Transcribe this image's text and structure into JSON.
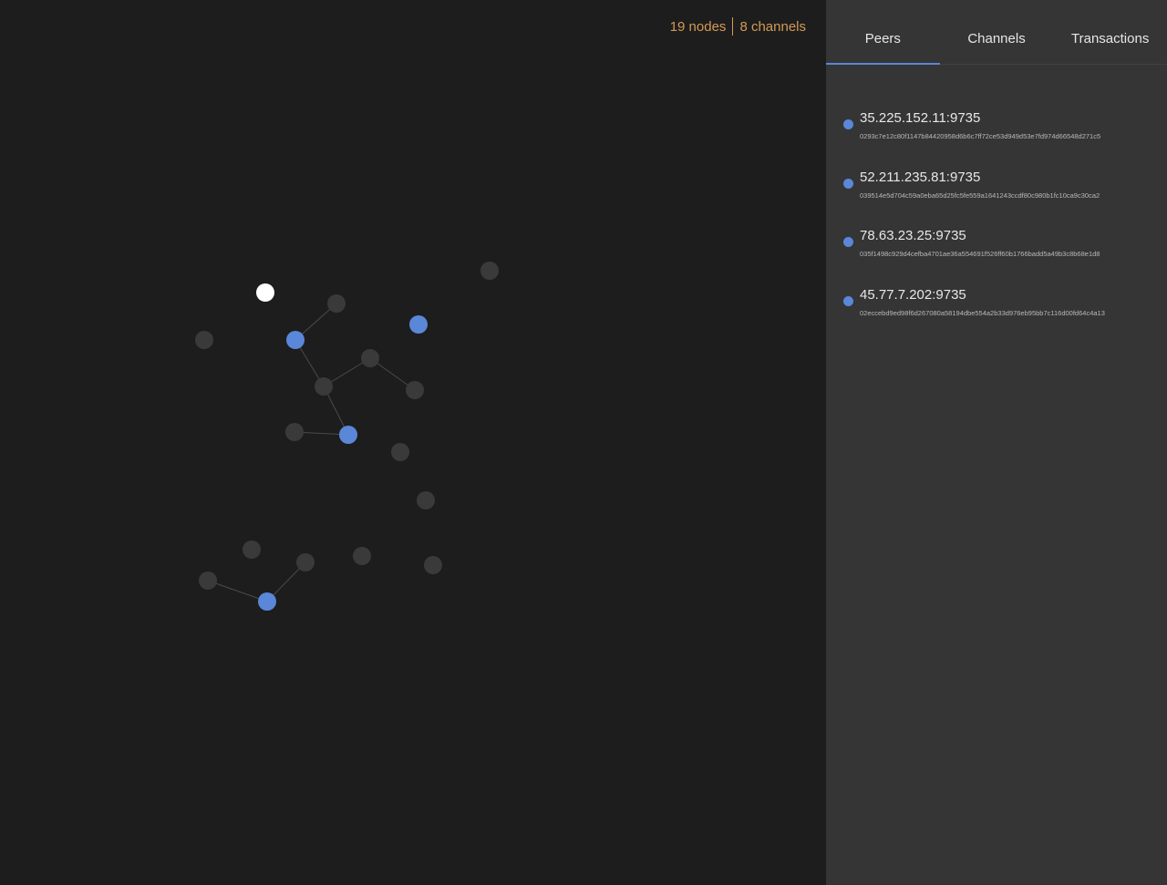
{
  "stats": {
    "nodes": "19 nodes",
    "channels": "8 channels"
  },
  "tabs": [
    {
      "label": "Peers",
      "active": true
    },
    {
      "label": "Channels",
      "active": false
    },
    {
      "label": "Transactions",
      "active": false
    }
  ],
  "peers": [
    {
      "address": "35.225.152.11:9735",
      "pubkey": "0293c7e12c80f1147b84420958d6b6c7ff72ce53d949d53e7fd974d66548d271c5"
    },
    {
      "address": "52.211.235.81:9735",
      "pubkey": "039514e5d704c59a0eba65d25fc5fe559a1641243ccdf80c980b1fc10ca9c30ca2"
    },
    {
      "address": "78.63.23.25:9735",
      "pubkey": "035f1498c929d4cefba4701ae36a554691f526ff60b1766badd5a49b3c8b68e1d8"
    },
    {
      "address": "45.77.7.202:9735",
      "pubkey": "02eccebd9ed98f6d267080a58194dbe554a2b33d976eb95bb7c116d00fd64c4a13"
    }
  ],
  "colors": {
    "background": "#1d1d1d",
    "sidebar": "#353535",
    "accent": "#5a87d8",
    "stats_text": "#d49a55",
    "node_default": "#3a3a3a",
    "node_self": "#ffffff",
    "node_peer": "#5a87d8"
  },
  "graph": {
    "nodes": [
      {
        "id": "n1",
        "kind": "self"
      },
      {
        "id": "n2",
        "kind": "other"
      },
      {
        "id": "n3",
        "kind": "other"
      },
      {
        "id": "n4",
        "kind": "peer"
      },
      {
        "id": "n5",
        "kind": "peer"
      },
      {
        "id": "n6",
        "kind": "other"
      },
      {
        "id": "n7",
        "kind": "other"
      },
      {
        "id": "n8",
        "kind": "other"
      },
      {
        "id": "n9",
        "kind": "other"
      },
      {
        "id": "n10",
        "kind": "peer"
      },
      {
        "id": "n11",
        "kind": "other"
      },
      {
        "id": "n12",
        "kind": "other"
      },
      {
        "id": "n13",
        "kind": "other"
      },
      {
        "id": "n14",
        "kind": "other"
      },
      {
        "id": "n15",
        "kind": "other"
      },
      {
        "id": "n16",
        "kind": "other"
      },
      {
        "id": "n17",
        "kind": "other"
      },
      {
        "id": "n18",
        "kind": "other"
      },
      {
        "id": "n19",
        "kind": "peer"
      }
    ],
    "edges": [
      [
        "n4",
        "n3"
      ],
      [
        "n4",
        "n8"
      ],
      [
        "n8",
        "n6"
      ],
      [
        "n6",
        "n9"
      ],
      [
        "n8",
        "n10"
      ],
      [
        "n10",
        "n11"
      ],
      [
        "n19",
        "n15"
      ],
      [
        "n19",
        "n16"
      ]
    ]
  }
}
